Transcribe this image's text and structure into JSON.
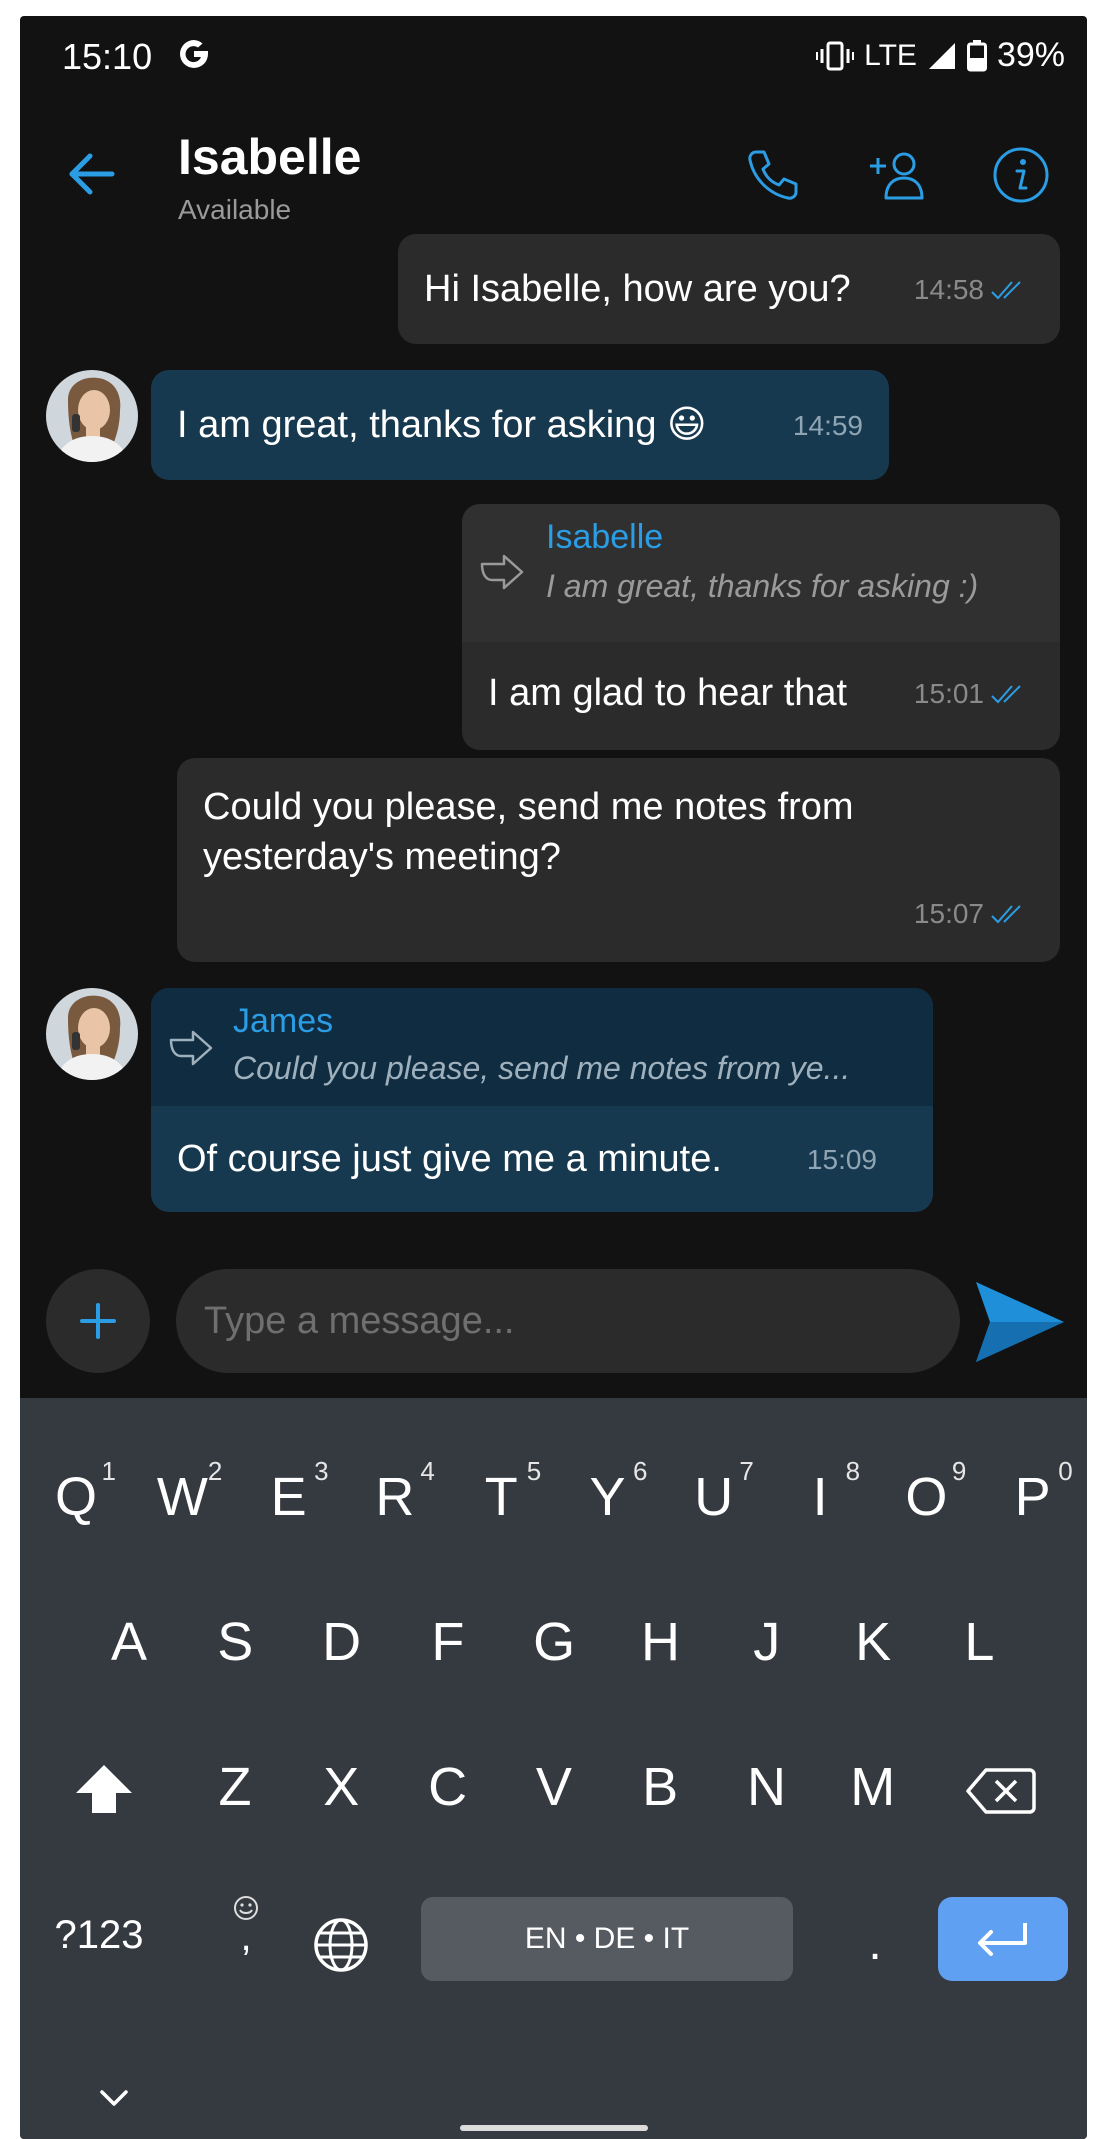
{
  "status_bar": {
    "time": "15:10",
    "network": "LTE",
    "battery": "39%"
  },
  "header": {
    "contact_name": "Isabelle",
    "contact_status": "Available"
  },
  "messages": [
    {
      "text": "Hi Isabelle, how are you?",
      "time": "14:58"
    },
    {
      "text": "I am great, thanks for asking 😃",
      "time": "14:59"
    },
    {
      "quote_author": "Isabelle",
      "quote_text": "I am great, thanks for asking :)",
      "text": "I am glad to hear that",
      "time": "15:01"
    },
    {
      "text": "Could you please, send me notes from yesterday's meeting?",
      "time": "15:07"
    },
    {
      "quote_author": "James",
      "quote_text": "Could you please, send me notes from ye...",
      "text": "Of course just give me a minute.",
      "time": "15:09"
    }
  ],
  "composer": {
    "placeholder": "Type a message..."
  },
  "keyboard": {
    "row1": [
      {
        "k": "Q",
        "h": "1"
      },
      {
        "k": "W",
        "h": "2"
      },
      {
        "k": "E",
        "h": "3"
      },
      {
        "k": "R",
        "h": "4"
      },
      {
        "k": "T",
        "h": "5"
      },
      {
        "k": "Y",
        "h": "6"
      },
      {
        "k": "U",
        "h": "7"
      },
      {
        "k": "I",
        "h": "8"
      },
      {
        "k": "O",
        "h": "9"
      },
      {
        "k": "P",
        "h": "0"
      }
    ],
    "row2": [
      "A",
      "S",
      "D",
      "F",
      "G",
      "H",
      "J",
      "K",
      "L"
    ],
    "row3": [
      "Z",
      "X",
      "C",
      "V",
      "B",
      "N",
      "M"
    ],
    "symbols_label": "?123",
    "comma": ",",
    "period": ".",
    "space_label": "EN • DE • IT"
  },
  "colors": {
    "accent": "#2b9de4",
    "background": "#121212",
    "outgoing_bubble": "#2b2b2b",
    "incoming_bubble": "#17394f",
    "keyboard_bg": "#353a40",
    "enter_key": "#5fa0f3"
  }
}
